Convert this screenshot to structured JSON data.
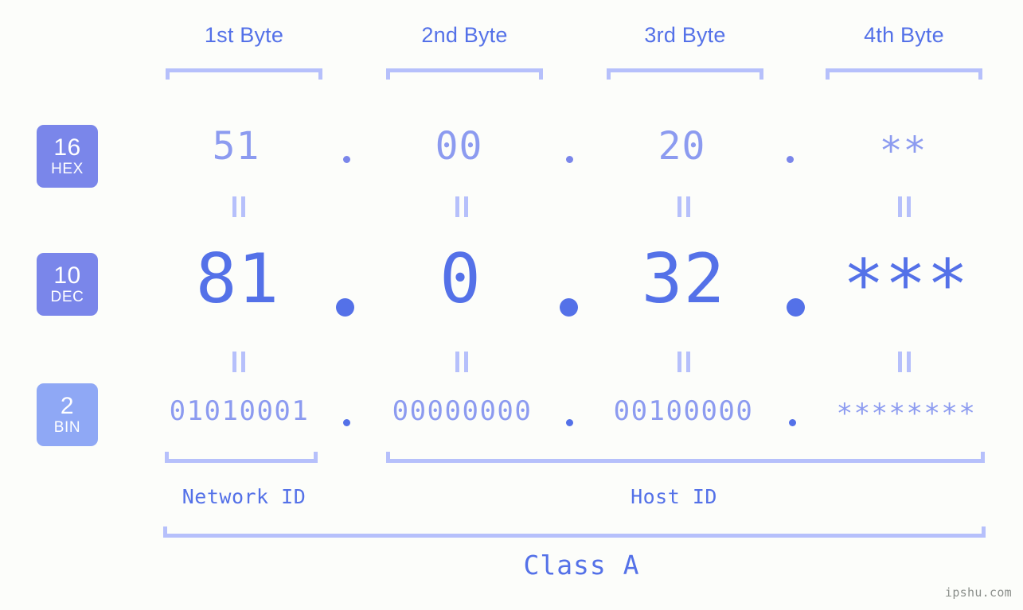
{
  "meta": {
    "background_color": "#fcfdfa",
    "accent_color": "#5471e8",
    "accent_light_color": "#8c9bf0",
    "accent_pale_color": "#b6c0fb",
    "badge_color": "#7a86ea",
    "badge_bin_color": "#8fa8f5",
    "watermark": "ipshu.com"
  },
  "header": {
    "byte_labels": [
      "1st Byte",
      "2nd Byte",
      "3rd Byte",
      "4th Byte"
    ]
  },
  "rows": [
    {
      "key": "hex",
      "badge_base": "16",
      "badge_name": "HEX",
      "values": [
        "51",
        "00",
        "20",
        "**"
      ],
      "separator": "."
    },
    {
      "key": "dec",
      "badge_base": "10",
      "badge_name": "DEC",
      "values": [
        "81",
        "0",
        "32",
        "***"
      ],
      "separator": "."
    },
    {
      "key": "bin",
      "badge_base": "2",
      "badge_name": "BIN",
      "values": [
        "01010001",
        "00000000",
        "00100000",
        "********"
      ],
      "separator": "."
    }
  ],
  "connectors": {
    "symbol": "=",
    "count_per_gap": 4
  },
  "footer": {
    "network_id_label": "Network ID",
    "host_id_label": "Host ID",
    "class_label": "Class A"
  }
}
